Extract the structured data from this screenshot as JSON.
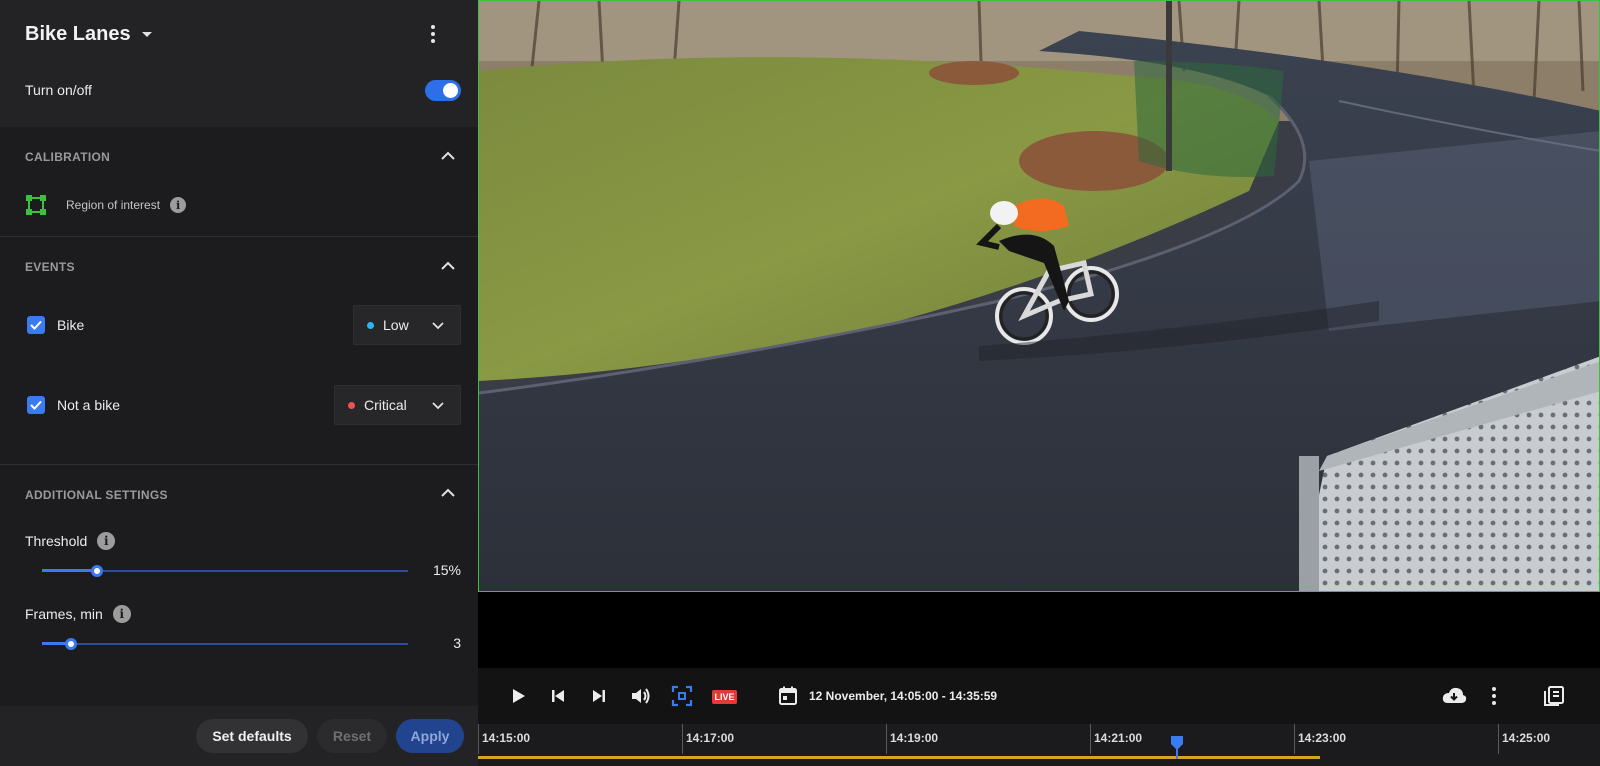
{
  "panel": {
    "title": "Bike Lanes",
    "toggle": {
      "label": "Turn on/off",
      "on": true
    },
    "calibration": {
      "title": "CALIBRATION",
      "roi_label": "Region of interest"
    },
    "events": {
      "title": "EVENTS",
      "items": [
        {
          "label": "Bike",
          "checked": true,
          "level": "Low",
          "level_color": "#29b6f6"
        },
        {
          "label": "Not a bike",
          "checked": true,
          "level": "Critical",
          "level_color": "#ef5350"
        }
      ]
    },
    "additional": {
      "title": "ADDITIONAL SETTINGS",
      "threshold": {
        "label": "Threshold",
        "value_text": "15%",
        "fraction": 0.15
      },
      "frames": {
        "label": "Frames, min",
        "value_text": "3",
        "fraction": 0.08
      }
    },
    "buttons": {
      "defaults": "Set defaults",
      "reset": "Reset",
      "apply": "Apply"
    }
  },
  "player": {
    "live_label": "LIVE",
    "range": "12 November, 14:05:00 - 14:35:59",
    "icons": [
      "play-icon",
      "skip-previous-icon",
      "skip-next-icon",
      "volume-icon",
      "fit-screen-icon",
      "calendar-icon",
      "cloud-download-icon",
      "more-vert-icon",
      "export-icon"
    ]
  },
  "timeline": {
    "ticks": [
      "14:15:00",
      "14:17:00",
      "14:19:00",
      "14:21:00",
      "14:23:00",
      "14:25:00"
    ],
    "progress_fraction": 0.75,
    "playhead_fraction": 0.623
  },
  "colors": {
    "accent": "#3a7bef",
    "roi_green": "#39c23d",
    "live_red": "#e53935",
    "timeline_progress": "#d7a324"
  }
}
